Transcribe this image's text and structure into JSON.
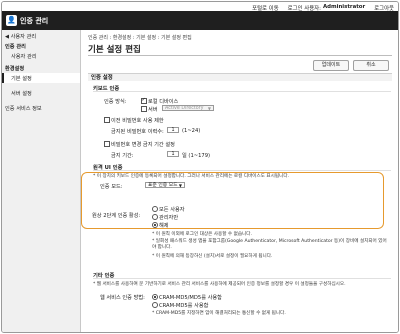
{
  "topbar": {
    "portal": "포털로 이동",
    "login_user_label": "로그인 사용자:",
    "user": "Administrator",
    "logout": "로그아웃"
  },
  "header": {
    "title": "인증 관리",
    "logo_icon": "user-key-icon"
  },
  "sidebar": {
    "back": "◀ 사용자 관리",
    "section1": "인증 관리",
    "item_users": "사용자 관리",
    "section2": "환경설정",
    "item_basic": "기본 설정",
    "item_server": "서버 설정",
    "item_service": "인증 서비스 정보"
  },
  "main": {
    "breadcrumb": "인증 관리 : 환경설정 : 기본 설정 : 기본 설정 편집",
    "title": "기본 설정 편집",
    "update_btn": "업데이트",
    "cancel_btn": "취소",
    "sec_auth": "인증 설정",
    "keyboard_hdr": "키보드 인증",
    "auth_method_label": "인증 방식:",
    "local_device": "로컬 디바이스",
    "server": "서버",
    "server_select": "Active Directory",
    "prev_pw_restrict": "이전 비밀번호 사용 제한",
    "prev_pw_label": "금지된 비밀번호 이력수:",
    "prev_pw_value": "1",
    "prev_pw_range": "(1~24)",
    "pw_period": "비밀번호 변경 금지 기간 설정",
    "period_label": "금지 기간:",
    "period_value": "1",
    "period_unit": "일 (1~179)",
    "sec_ui": "원격 UI 인증",
    "ui_note": "* 이 장치의 키보드 인증에 등록되어 설정합니다. 그러나 서비스 관리에는 로컬 디바이스도 표시됩니다.",
    "auth_mode_label": "인증 모드:",
    "auth_mode_value": "표준 인증 모드",
    "twofa_label": "원상 2단계 인증 활성:",
    "opt_all": "모든 사용자",
    "opt_admin": "관리자만",
    "opt_off": "해제",
    "note1": "* 이 원칙 이외에 로그인 대상은 사용할 수 없습니다.",
    "note2": "* 일회성 패스워드 생성 앱을 포함그룹(Google Authenticator, Microsoft Authenticator 등)이 장비에 설치되어 있어야 합니다.",
    "note3": "* 이 원칙에 의해 등장하신 (설치)서로 설정이 필요하게 됩니다.",
    "sec_other": "기타 인증",
    "other_note": "* 웹 서비스를 사용하여 문 기반하기로 서비스 관리 서비스를 사용하에 제공되어 인증 정보를 설정할 경우 이 설정들을 구성하십시오.",
    "web_auth_label": "웹 서비스 인증 방법:",
    "opt_md5_sha": "CRAM-MD5/MD5를 사용함",
    "opt_md5": "CRAM-MD5를 사용함",
    "web_note": "* CRAM-MD5를 지정하면 암이 해결처리되는 통신할 수 없게 됩니다."
  }
}
